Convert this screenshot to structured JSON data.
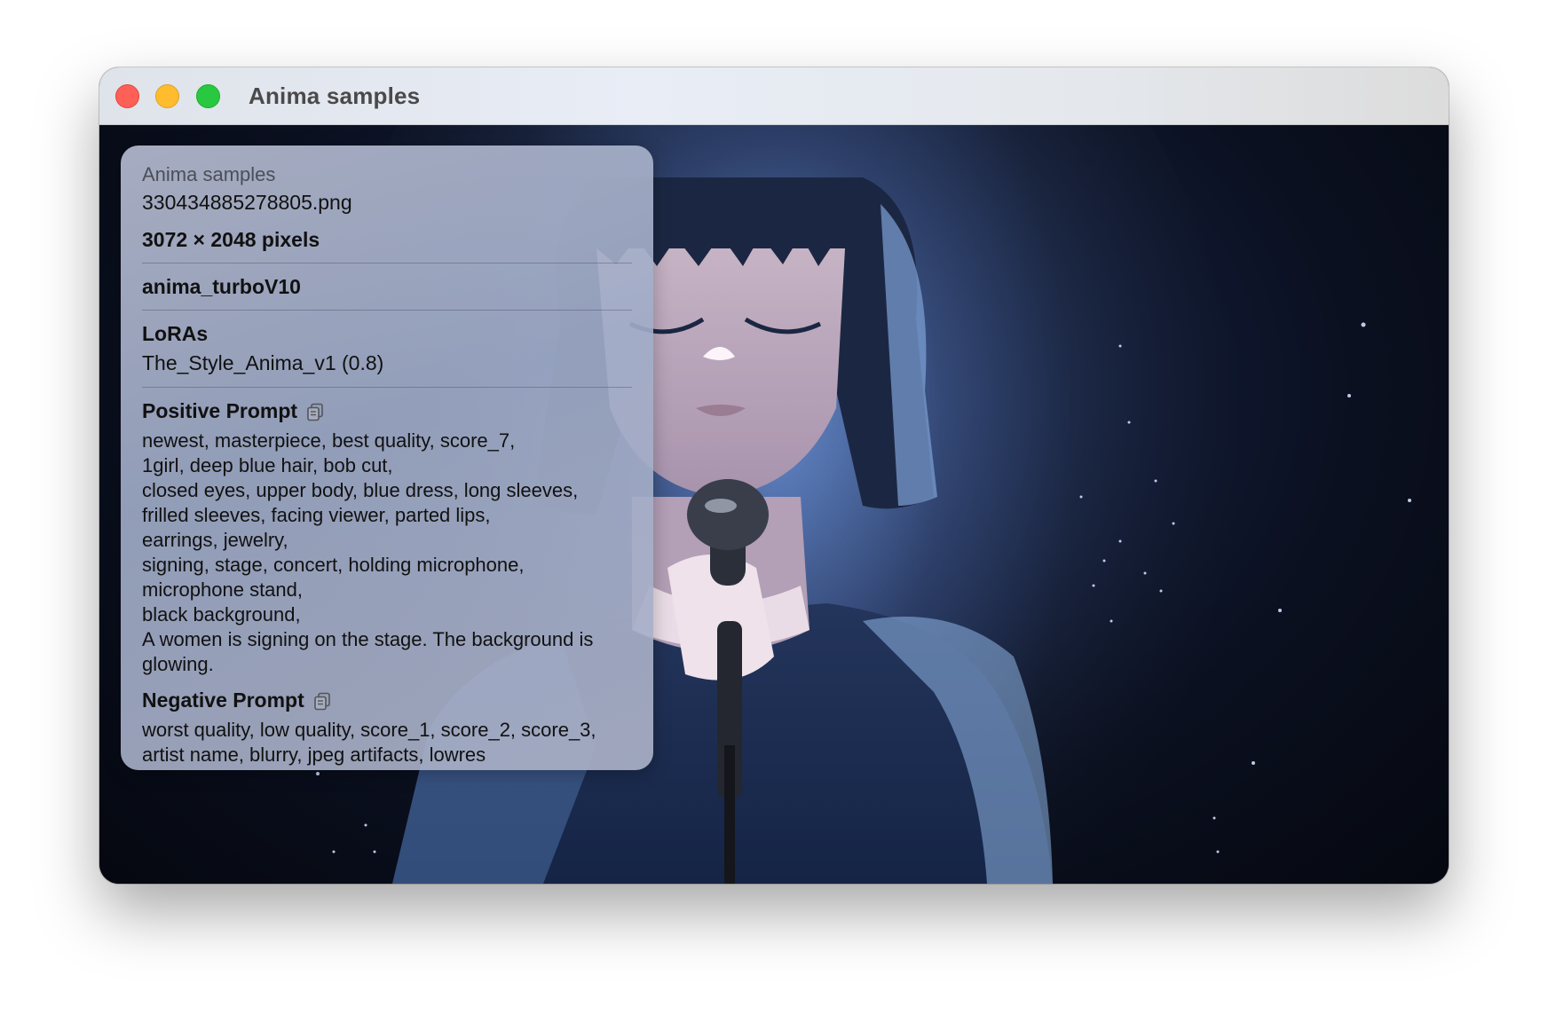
{
  "window": {
    "title": "Anima samples"
  },
  "info_panel": {
    "album": "Anima samples",
    "filename": "330434885278805.png",
    "dimensions": "3072 × 2048 pixels",
    "model": "anima_turboV10",
    "loras": {
      "heading": "LoRAs",
      "value": "The_Style_Anima_v1 (0.8)"
    },
    "positive_prompt": {
      "heading": "Positive Prompt",
      "lines": [
        "newest, masterpiece, best quality, score_7,",
        "1girl, deep blue hair, bob cut,",
        "closed eyes, upper body, blue dress, long sleeves,",
        "frilled sleeves, facing viewer, parted lips,",
        "earrings, jewelry,",
        "signing, stage, concert, holding microphone,",
        "microphone stand,",
        "black background,",
        "A women is signing on the stage. The background is",
        "glowing."
      ]
    },
    "negative_prompt": {
      "heading": "Negative Prompt",
      "lines": [
        "worst quality, low quality, score_1, score_2, score_3,",
        "artist name, blurry, jpeg artifacts, lowres"
      ]
    }
  },
  "icons": {
    "copy": "copy-icon"
  },
  "colors": {
    "close": "#fe5f57",
    "minimize": "#febc2e",
    "zoom": "#28c840"
  }
}
